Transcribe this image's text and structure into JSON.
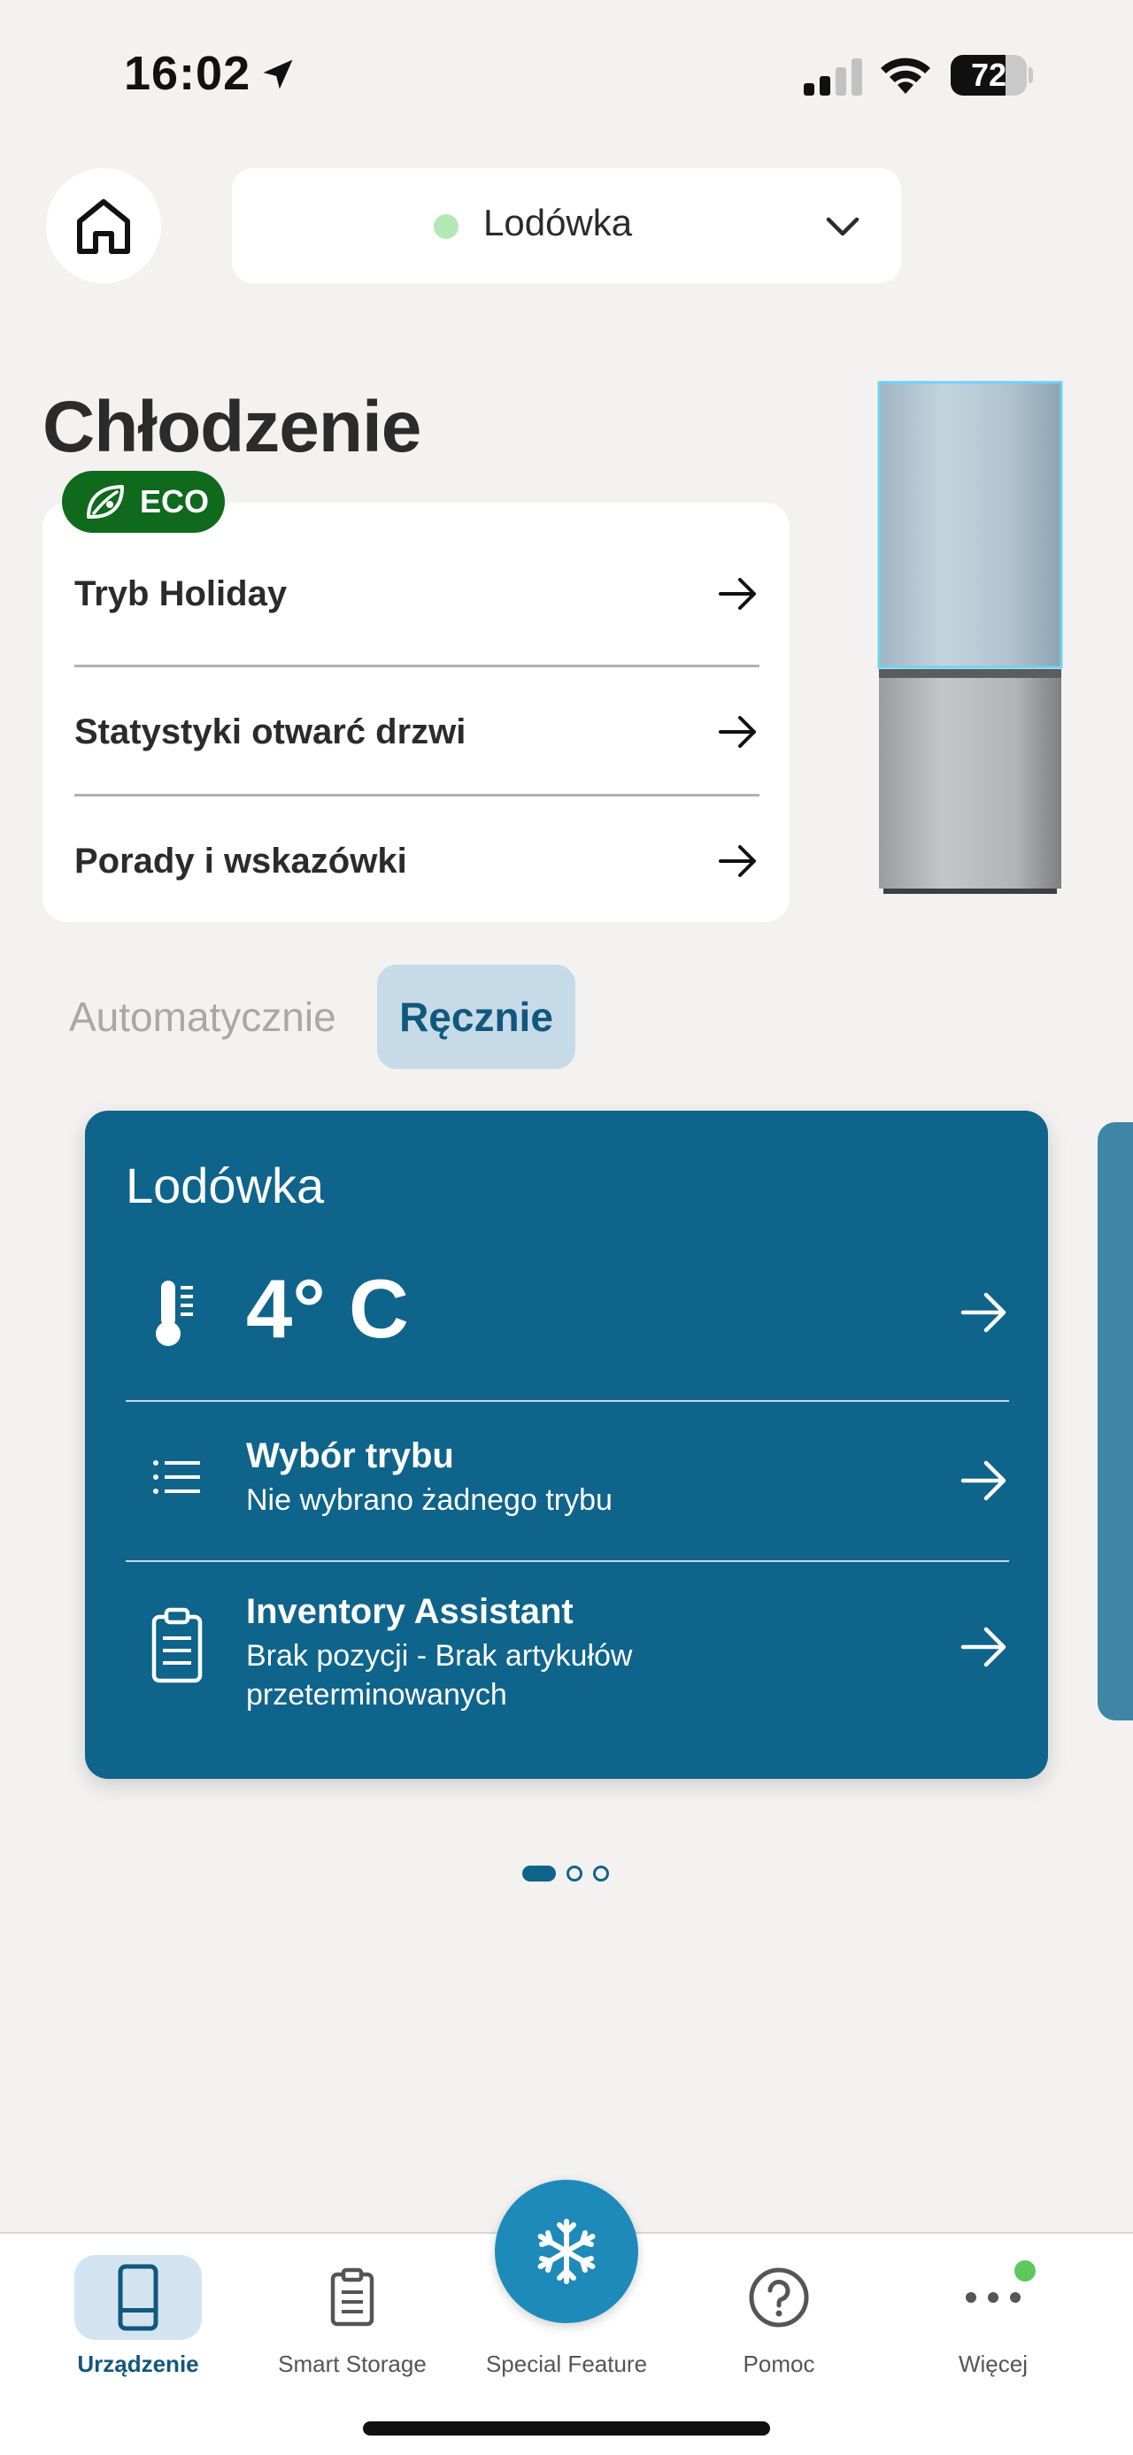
{
  "status_bar": {
    "time": "16:02",
    "battery": "72",
    "battery_level": 0.72
  },
  "header": {
    "device_name": "Lodówka",
    "device_status_color": "#b4e8b6"
  },
  "section": {
    "title": "Chłodzenie",
    "eco_label": "ECO",
    "menu": [
      {
        "label": "Tryb Holiday"
      },
      {
        "label": "Statystyki otwarć drzwi"
      },
      {
        "label": "Porady i wskazówki"
      }
    ]
  },
  "mode_toggle": {
    "auto": "Automatycznie",
    "manual": "Ręcznie",
    "selected": "manual"
  },
  "card": {
    "title": "Lodówka",
    "temperature": "4° C",
    "mode_title": "Wybór trybu",
    "mode_sub": "Nie wybrano żadnego trybu",
    "inventory_title": "Inventory Assistant",
    "inventory_sub": "Brak pozycji - Brak artykułów przeterminowanych"
  },
  "pager": {
    "pages": 3,
    "current": 1
  },
  "bottom_nav": {
    "items": [
      {
        "label": "Urządzenie",
        "icon": "fridge-icon",
        "active": true
      },
      {
        "label": "Smart Storage",
        "icon": "clipboard-icon",
        "active": false
      },
      {
        "label": "Special Feature",
        "icon": "snowflake-icon",
        "active": false
      },
      {
        "label": "Pomoc",
        "icon": "help-icon",
        "active": false
      },
      {
        "label": "Więcej",
        "icon": "more-icon",
        "active": false
      }
    ]
  },
  "colors": {
    "accent": "#0e648b",
    "eco": "#0f6a1e",
    "fab": "#1e8ab9",
    "background": "#f3f2f0"
  }
}
